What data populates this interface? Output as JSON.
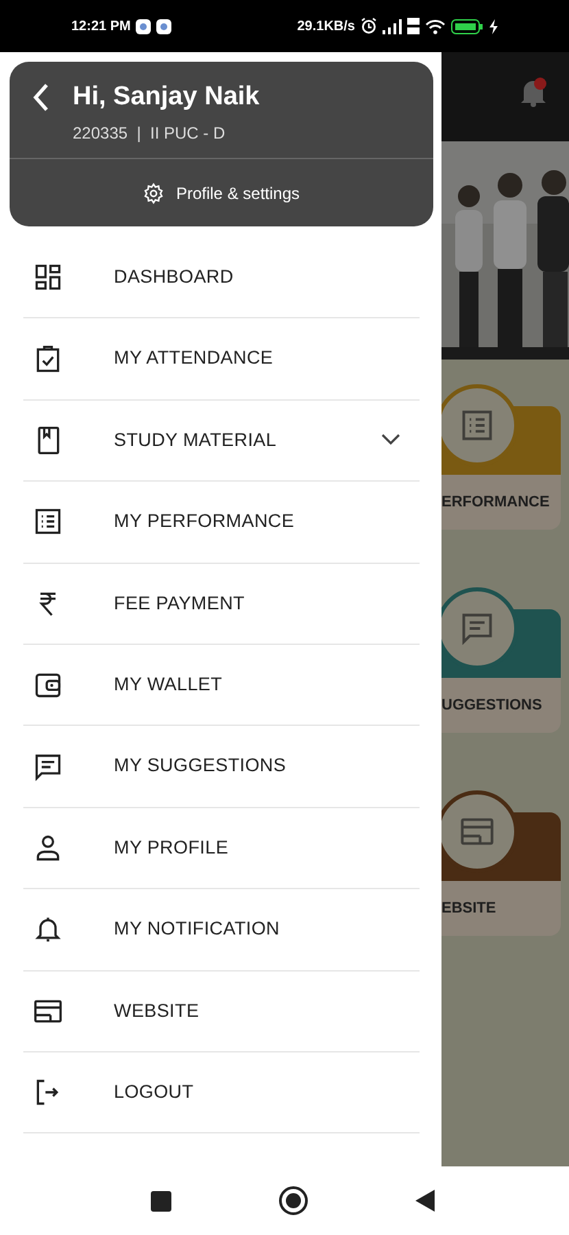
{
  "status_bar": {
    "time": "12:21 PM",
    "speed": "29.1KB/s"
  },
  "drawer": {
    "greeting": "Hi, Sanjay Naik",
    "subtitle": "220335  |  II PUC - D",
    "settings_label": "Profile & settings",
    "items": [
      {
        "label": "DASHBOARD",
        "kind": "dashboard",
        "expandable": false
      },
      {
        "label": "MY ATTENDANCE",
        "kind": "attendance",
        "expandable": false
      },
      {
        "label": "STUDY MATERIAL",
        "kind": "book",
        "expandable": true
      },
      {
        "label": "MY PERFORMANCE",
        "kind": "list",
        "expandable": false
      },
      {
        "label": "FEE PAYMENT",
        "kind": "rupee",
        "expandable": false
      },
      {
        "label": "MY WALLET",
        "kind": "wallet",
        "expandable": false
      },
      {
        "label": "MY SUGGESTIONS",
        "kind": "chat",
        "expandable": false
      },
      {
        "label": "MY PROFILE",
        "kind": "person",
        "expandable": false
      },
      {
        "label": "MY NOTIFICATION",
        "kind": "bell",
        "expandable": false
      },
      {
        "label": "WEBSITE",
        "kind": "card",
        "expandable": false
      },
      {
        "label": "LOGOUT",
        "kind": "logout",
        "expandable": false
      }
    ]
  },
  "background_tiles": [
    {
      "label": "ERFORMANCE",
      "kind": "list",
      "color": "#7a5a12"
    },
    {
      "label": "UGGESTIONS",
      "kind": "chat",
      "color": "#1f5350"
    },
    {
      "label": "EBSITE",
      "kind": "card",
      "color": "#4a2c14"
    }
  ]
}
